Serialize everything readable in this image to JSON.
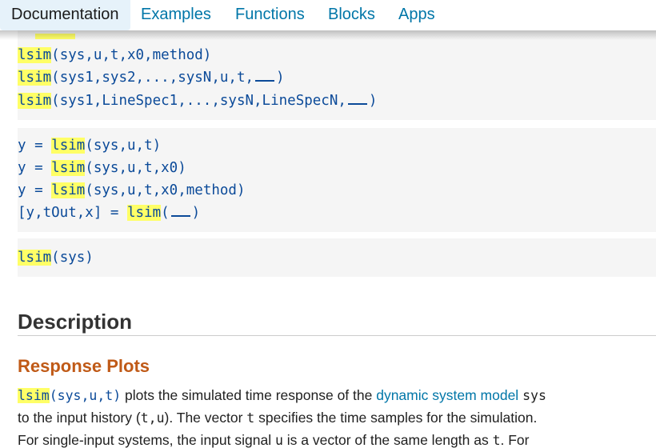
{
  "nav": {
    "tabs": [
      "Documentation",
      "Examples",
      "Functions",
      "Blocks",
      "Apps"
    ],
    "active_tab": "Documentation"
  },
  "syntax_block_1": {
    "line1": {
      "fn": "lsim",
      "args": "(sys,u,t,x0,method)"
    },
    "line2": {
      "fn": "lsim",
      "args_before": "(sys1,sys2,...,sysN,u,t,",
      "args_after": ")"
    },
    "line3": {
      "fn": "lsim",
      "args_before": "(sys1,LineSpec1,...,sysN,LineSpecN,",
      "args_after": ")"
    }
  },
  "syntax_block_2": {
    "line1": {
      "lhs": "y = ",
      "fn": "lsim",
      "args": "(sys,u,t)"
    },
    "line2": {
      "lhs": "y = ",
      "fn": "lsim",
      "args": "(sys,u,t,x0)"
    },
    "line3": {
      "lhs": "y = ",
      "fn": "lsim",
      "args": "(sys,u,t,x0,method)"
    },
    "line4": {
      "lhs": "[y,tOut,x] = ",
      "fn": "lsim",
      "args_before": "(",
      "args_after": ")"
    }
  },
  "syntax_block_3": {
    "line1": {
      "fn": "lsim",
      "args": "(sys)"
    }
  },
  "section": {
    "heading": "Description",
    "subheading": "Response Plots"
  },
  "description": {
    "p1_fn": "lsim",
    "p1_args": "(sys,u,t)",
    "p1_text": " plots the simulated time response of the ",
    "p1_link": "dynamic system model",
    "p1_space": " ",
    "p1_sys": "sys",
    "p2_a": "to the input history (",
    "p2_tu": "t,u",
    "p2_b": "). The vector ",
    "p2_t": "t",
    "p2_c": " specifies the time samples for the simulation.",
    "p3_a": "For single-input systems, the input signal ",
    "p3_u": "u",
    "p3_b": " is a vector of the same length as ",
    "p3_t": "t",
    "p3_c": ". For"
  },
  "colors": {
    "link": "#0076a8",
    "code": "#0b4a99",
    "highlight": "#ffff66",
    "subheading": "#c05a17",
    "code_bg": "#f5f5f5"
  }
}
